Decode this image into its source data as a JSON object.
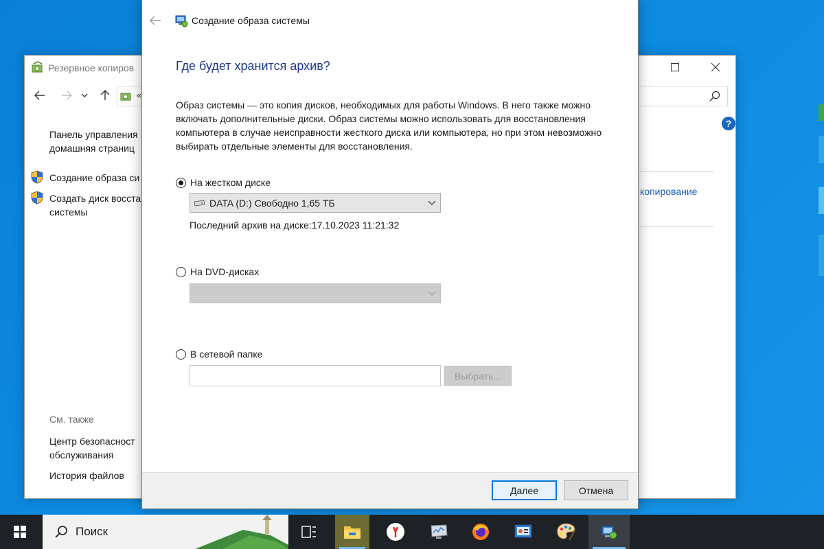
{
  "background_window": {
    "title": "Резервное копиров",
    "address_chevron": "«",
    "nav_links": [
      {
        "line1": "Панель управления",
        "line2": "домашняя страниц"
      }
    ],
    "tasks": [
      {
        "label": "Создание образа си"
      },
      {
        "line1": "Создать диск восста",
        "line2": "системы"
      }
    ],
    "see_also_label": "См. также",
    "see_also_links": [
      {
        "line1": "Центр безопасност",
        "line2": "обслуживания"
      },
      {
        "line1": "История файлов"
      }
    ],
    "right_link": "копирование",
    "help_label": "?"
  },
  "dialog": {
    "title": "Создание образа системы",
    "heading": "Где будет хранится архив?",
    "description": "Образ системы — это копия дисков, необходимых для работы Windows. В него также можно включать дополнительные диски. Образ системы можно использовать для восстановления компьютера в случае неисправности жесткого диска или компьютера, но при этом невозможно выбирать отдельные элементы для восстановления.",
    "options": {
      "hard_disk": {
        "label": "На жестком диске",
        "selected": true,
        "drive_value": "DATA (D:)  Свободно 1,65 ТБ",
        "last_archive_label": "Последний архив на диске:",
        "last_archive_value": "17.10.2023 11:21:32"
      },
      "dvd": {
        "label": "На DVD-дисках",
        "selected": false,
        "drive_value": ""
      },
      "network": {
        "label": "В сетевой папке",
        "selected": false,
        "path_value": "",
        "browse_label": "Выбрать..."
      }
    },
    "next_label": "Далее",
    "cancel_label": "Отмена"
  },
  "taskbar": {
    "search_placeholder": "Поиск",
    "items": [
      {
        "name": "task-view",
        "icon": "task-view-icon"
      },
      {
        "name": "file-explorer",
        "icon": "folder-icon"
      },
      {
        "name": "yandex-browser",
        "icon": "yandex-icon"
      },
      {
        "name": "resource-monitor",
        "icon": "monitor-icon"
      },
      {
        "name": "firefox",
        "icon": "firefox-icon"
      },
      {
        "name": "control-panel",
        "icon": "control-panel-icon"
      },
      {
        "name": "paint",
        "icon": "palette-icon"
      },
      {
        "name": "backup-wizard",
        "icon": "backup-icon"
      }
    ]
  },
  "colors": {
    "accent": "#0078d7",
    "heading": "#1e3a8a",
    "link": "#1a5fb4",
    "taskbar": "#1e2126",
    "desktop": "#0c8be0"
  }
}
